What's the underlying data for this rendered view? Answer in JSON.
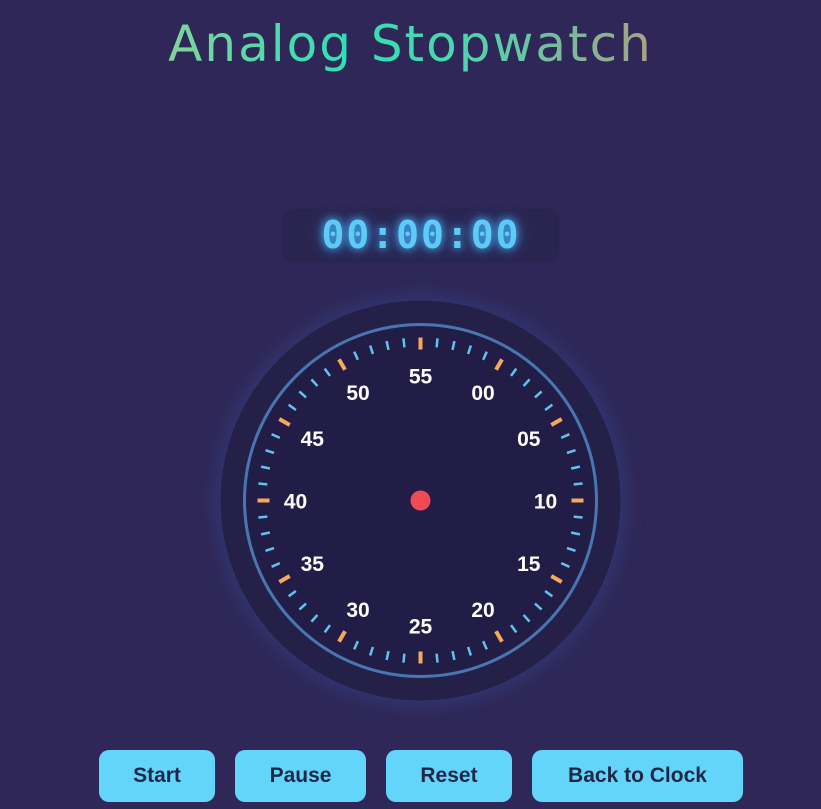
{
  "page": {
    "title": "Analog Stopwatch"
  },
  "display": {
    "time": "00:00:00"
  },
  "dial": {
    "labels": [
      "00",
      "05",
      "10",
      "15",
      "20",
      "25",
      "30",
      "35",
      "40",
      "45",
      "50",
      "55"
    ],
    "hand_seconds": 0,
    "colors": {
      "tick_minor": "#5ec3f0",
      "tick_major": "#f6a95a",
      "label": "#ffffff",
      "face": "#221d46",
      "rim": "#3a5a8a",
      "hand_top": "#39c8e4",
      "hand_bottom": "#8fd9a6",
      "pivot": "#f04a55"
    }
  },
  "controls": {
    "start_label": "Start",
    "pause_label": "Pause",
    "reset_label": "Reset",
    "back_label": "Back to Clock"
  },
  "colors": {
    "background": "#2e2757",
    "button": "#63d5fa",
    "button_text": "#1f2747",
    "digital": "#5ecbf6"
  }
}
